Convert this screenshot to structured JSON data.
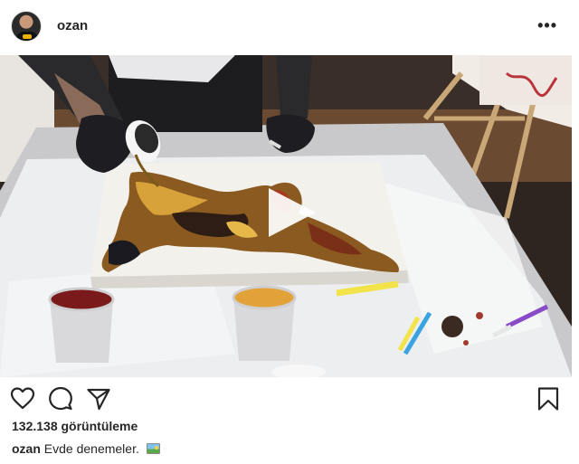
{
  "post": {
    "username": "ozan",
    "more_icon": "more-horizontal-icon",
    "views_text": "132.138 görüntüleme",
    "caption_username": "ozan",
    "caption_text": "Evde denemeler.",
    "caption_emoji": "framed-picture-emoji"
  },
  "actions": {
    "icons": [
      "heart-icon",
      "comment-icon",
      "share-icon",
      "bookmark-icon"
    ]
  },
  "media": {
    "type": "video",
    "play_icon": "play-icon"
  }
}
